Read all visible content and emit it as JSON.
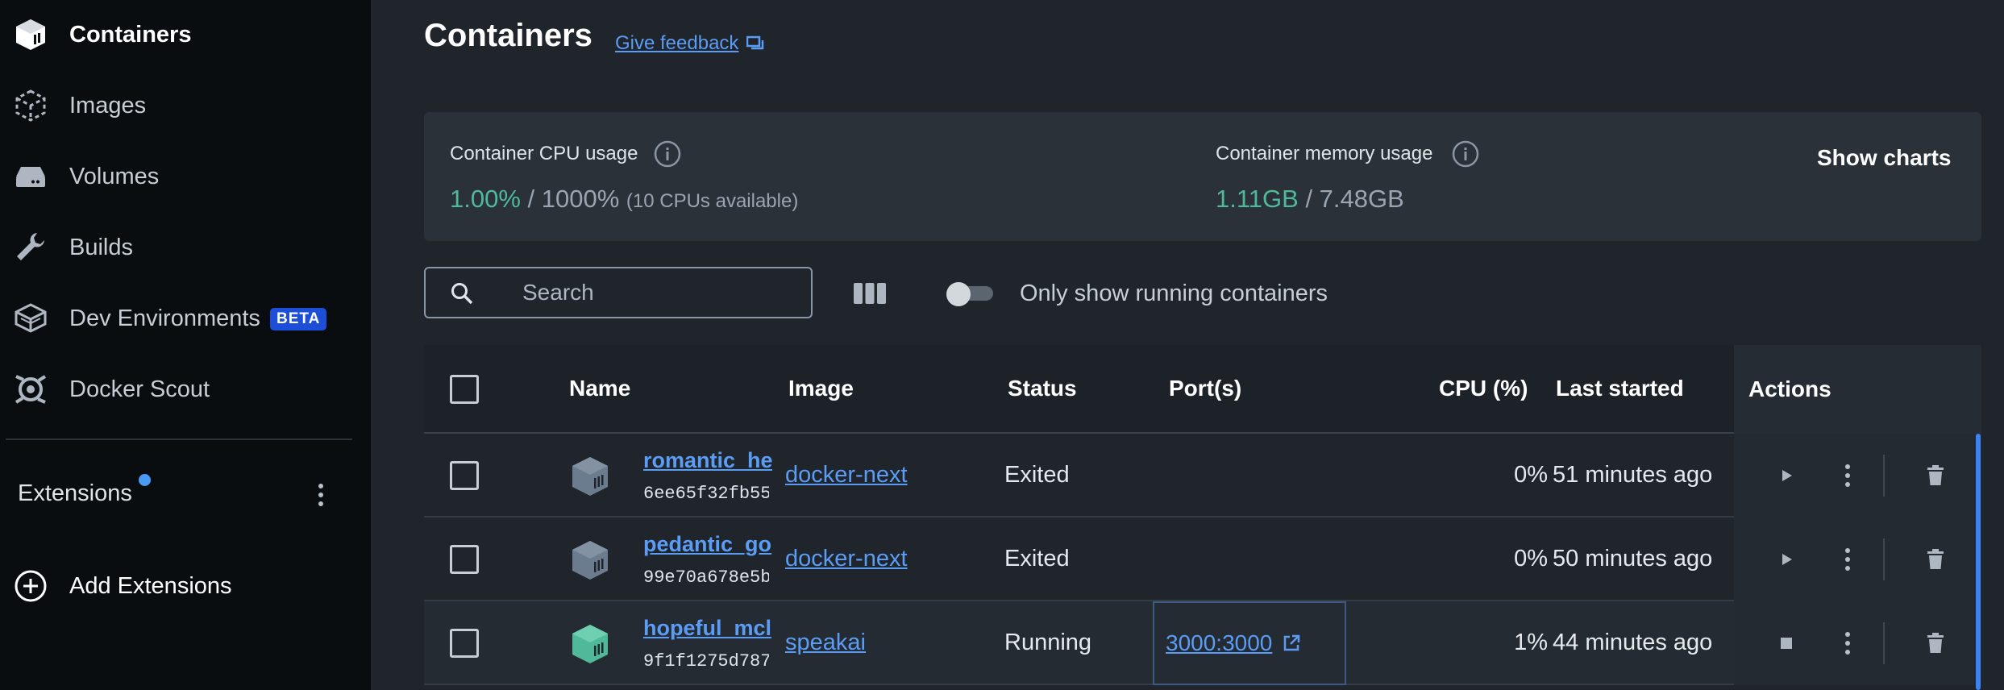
{
  "sidebar": {
    "items": [
      {
        "label": "Containers",
        "icon": "containers-icon",
        "active": true
      },
      {
        "label": "Images",
        "icon": "images-icon"
      },
      {
        "label": "Volumes",
        "icon": "volumes-icon"
      },
      {
        "label": "Builds",
        "icon": "wrench-icon"
      },
      {
        "label": "Dev Environments",
        "icon": "dev-environments-icon",
        "badge": "BETA"
      },
      {
        "label": "Docker Scout",
        "icon": "docker-scout-icon"
      }
    ],
    "extensions_label": "Extensions",
    "add_extensions_label": "Add Extensions"
  },
  "header": {
    "title": "Containers",
    "feedback_label": "Give feedback"
  },
  "stats": {
    "cpu": {
      "label": "Container CPU usage",
      "used": "1.00%",
      "separator": " / ",
      "total": "1000%",
      "note": "(10 CPUs available)"
    },
    "memory": {
      "label": "Container memory usage",
      "used": "1.11GB",
      "separator": " / ",
      "total": "7.48GB"
    },
    "show_charts_label": "Show charts"
  },
  "toolbar": {
    "search_placeholder": "Search",
    "running_toggle_label": "Only show running containers",
    "running_toggle_on": false
  },
  "table": {
    "columns": [
      "Name",
      "Image",
      "Status",
      "Port(s)",
      "CPU (%)",
      "Last started",
      "Actions"
    ],
    "rows": [
      {
        "name": "romantic_he",
        "id": "6ee65f32fb55",
        "image": "docker-next",
        "status": "Exited",
        "ports": "",
        "cpu": "0%",
        "last_started": "51 minutes ago",
        "running": false
      },
      {
        "name": "pedantic_go",
        "id": "99e70a678e5b",
        "image": "docker-next",
        "status": "Exited",
        "ports": "",
        "cpu": "0%",
        "last_started": "50 minutes ago",
        "running": false
      },
      {
        "name": "hopeful_mcl",
        "id": "9f1f1275d787",
        "image": "speakai",
        "status": "Running",
        "ports": "3000:3000",
        "cpu": "1%",
        "last_started": "44 minutes ago",
        "running": true
      }
    ]
  },
  "colors": {
    "accent": "#5b9cf5",
    "running_green": "#4fb99a",
    "exited_gray": "#6b7c8f",
    "beta_badge": "#1d4ed8"
  }
}
